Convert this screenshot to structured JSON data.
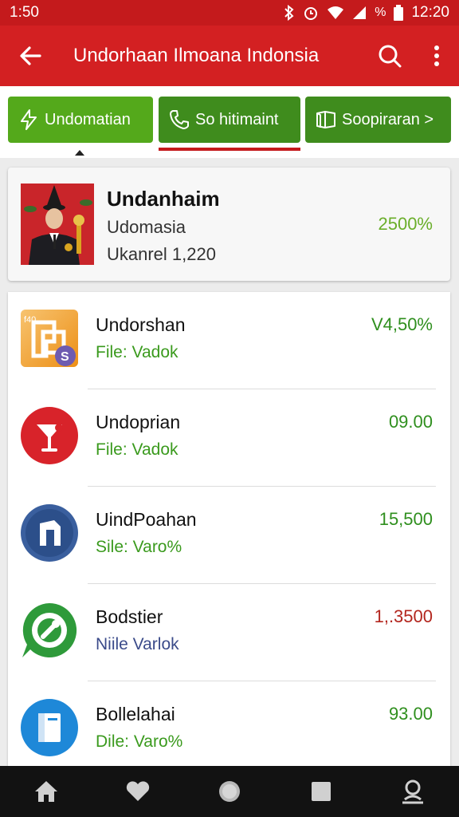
{
  "status_bar": {
    "time": "1:50",
    "battery": "%",
    "clock": "12:20"
  },
  "app_bar": {
    "title": "Undorhaan Ilmoana Indonsia"
  },
  "tabs": [
    {
      "label": "Undomatian",
      "icon": "bolt-icon"
    },
    {
      "label": "So hitimaint",
      "icon": "phone-icon"
    },
    {
      "label": "Soopiraran >",
      "icon": "book-icon"
    }
  ],
  "featured": {
    "title": "Undanhaim",
    "subtitle": "Udomasia",
    "meta": "Ukanrel 1,220",
    "value": "2500%"
  },
  "list": [
    {
      "name": "Undorshan",
      "subtitle": "File: Vadok",
      "value": "V4,50%",
      "value_color": "#2f8f1e",
      "sub_color": "#3a9a1d",
      "icon": "chat-icon"
    },
    {
      "name": "Undoprian",
      "subtitle": "File: Vadok",
      "value": "09.00",
      "value_color": "#2f8f1e",
      "sub_color": "#3a9a1d",
      "icon": "cocktail-icon"
    },
    {
      "name": "UindPoahan",
      "subtitle": "Sile: Varo%",
      "value": "15,500",
      "value_color": "#2f8f1e",
      "sub_color": "#3a9a1d",
      "icon": "shield-icon"
    },
    {
      "name": "Bodstier",
      "subtitle": "Niile Varlok",
      "value": "1,.3500",
      "value_color": "#b3261e",
      "sub_color": "#3b4b8a",
      "icon": "whatsapp-icon"
    },
    {
      "name": "Bollelahai",
      "subtitle": "Dile: Varo%",
      "value": "93.00",
      "value_color": "#2f8f1e",
      "sub_color": "#3a9a1d",
      "icon": "document-icon"
    }
  ],
  "colors": {
    "primary": "#d32022",
    "tab_green": "#54a91b",
    "tab_dark_green": "#3f8c1d"
  }
}
